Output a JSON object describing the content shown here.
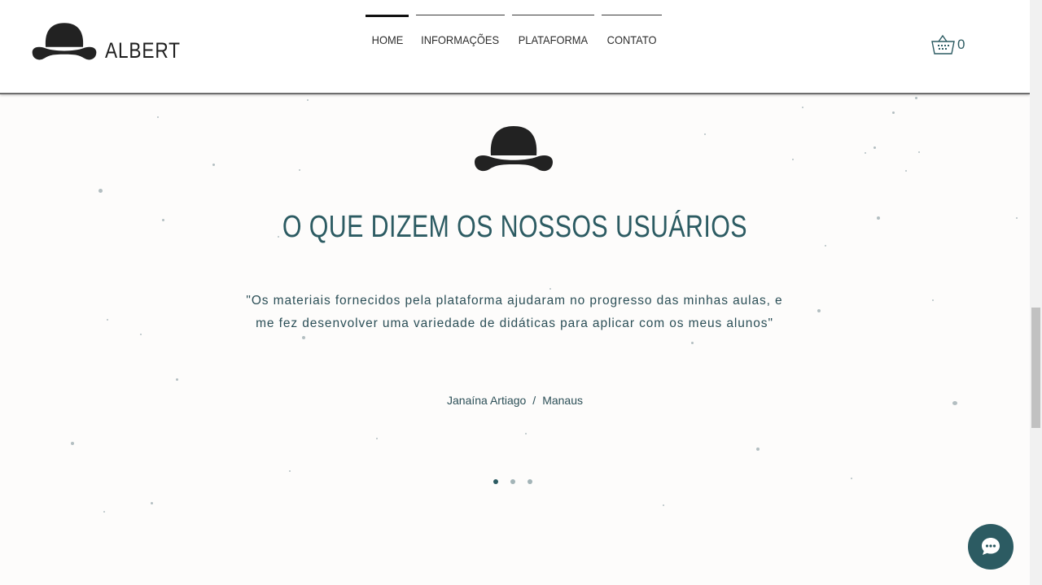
{
  "brand": {
    "name": "ALBERT",
    "icon": "bowler-hat-icon"
  },
  "nav": {
    "items": [
      {
        "label": "HOME",
        "active": true
      },
      {
        "label": "INFORMAÇÕES",
        "active": false
      },
      {
        "label": "PLATAFORMA",
        "active": false
      },
      {
        "label": "CONTATO",
        "active": false
      }
    ]
  },
  "cart": {
    "icon": "shopping-basket-icon",
    "count": "0"
  },
  "testimonials": {
    "icon": "bowler-hat-icon",
    "heading": "O QUE DIZEM OS NOSSOS USUÁRIOS",
    "quote": "\"Os materiais fornecidos pela plataforma ajudaram no progresso das minhas aulas, e me fez desenvolver uma variedade de didáticas para aplicar com os meus alunos\"",
    "author_name": "Janaína Artiago",
    "separator": "/",
    "author_city": "Manaus",
    "slide_count": 3,
    "active_slide": 1
  },
  "chat": {
    "icon": "chat-bubble-icon"
  },
  "colors": {
    "accent": "#2c5b62",
    "background": "#fdfcfb",
    "header": "#ffffff",
    "text_dark": "#1e1e1e"
  }
}
